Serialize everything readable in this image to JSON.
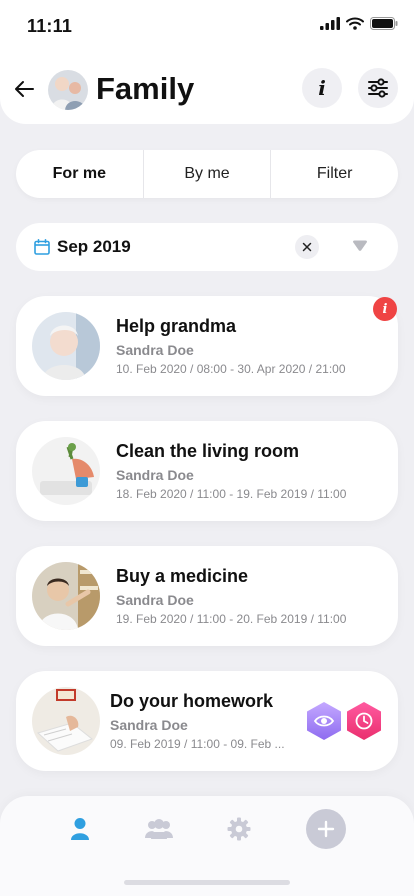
{
  "status": {
    "time": "11:11"
  },
  "header": {
    "title": "Family"
  },
  "segments": [
    {
      "label": "For me",
      "active": true
    },
    {
      "label": "By me",
      "active": false
    },
    {
      "label": "Filter",
      "active": false
    }
  ],
  "date_filter": {
    "value": "Sep 2019"
  },
  "tasks": [
    {
      "title": "Help grandma",
      "assignee": "Sandra Doe",
      "period": "10. Feb 2020 / 08:00 - 30. Apr 2020 / 21:00",
      "badge": "i"
    },
    {
      "title": "Clean the living room",
      "assignee": "Sandra Doe",
      "period": "18. Feb 2020 / 11:00 - 19. Feb 2019 / 11:00"
    },
    {
      "title": "Buy a medicine",
      "assignee": "Sandra Doe",
      "period": "19. Feb 2020 / 11:00 - 20. Feb 2019 / 11:00"
    },
    {
      "title": "Do your homework",
      "assignee": "Sandra Doe",
      "period": "09. Feb 2019 / 11:00 - 09. Feb ..."
    }
  ],
  "icons": {
    "accent": "#2f9fe0",
    "alert": "#ef4444",
    "watch_gradient": [
      "#c4a8ff",
      "#8e6cf0"
    ],
    "clock_gradient": [
      "#ff5aa0",
      "#ea2f6e"
    ]
  }
}
